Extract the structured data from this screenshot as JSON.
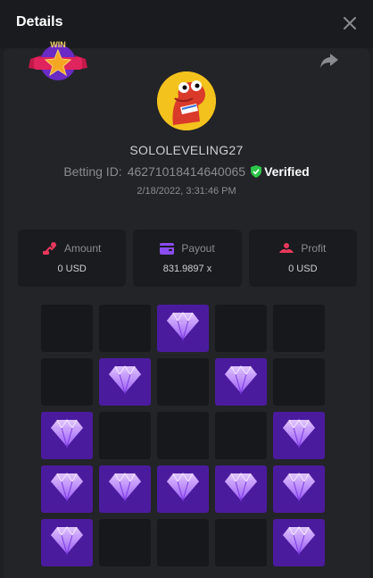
{
  "modal": {
    "title": "Details"
  },
  "user": {
    "username": "SOLOLEVELING27",
    "betting_id_label": "Betting ID:",
    "betting_id": "46271018414640065",
    "verified_label": "Verified",
    "timestamp": "2/18/2022, 3:31:46 PM",
    "badge_text": "WIN"
  },
  "stats": [
    {
      "label": "Amount",
      "value": "0 USD",
      "icon": "amount-icon",
      "color": "#e8385c"
    },
    {
      "label": "Payout",
      "value": "831.9897 x",
      "icon": "wallet-icon",
      "color": "#8a4cf0"
    },
    {
      "label": "Profit",
      "value": "0 USD",
      "icon": "profit-icon",
      "color": "#e8385c"
    }
  ],
  "board": {
    "rows": 5,
    "cols": 5,
    "tiles": [
      [
        0,
        0,
        1,
        0,
        0
      ],
      [
        0,
        1,
        0,
        1,
        0
      ],
      [
        1,
        0,
        0,
        0,
        1
      ],
      [
        1,
        1,
        1,
        1,
        1
      ],
      [
        1,
        0,
        0,
        0,
        1
      ]
    ]
  },
  "colors": {
    "gem_tile": "#4b1b9e",
    "empty_tile": "#17181b",
    "verified_green": "#2bc54a"
  }
}
